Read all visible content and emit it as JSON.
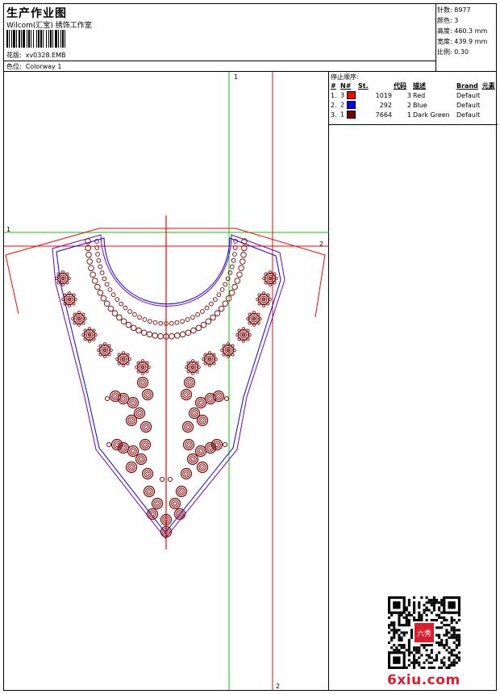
{
  "header": {
    "title": "生产作业图",
    "company": "Wilcom(汇宝) 绣饰工作室",
    "design_label": "花版:",
    "design_value": "xv0328.EMB",
    "color_label": "色位:",
    "color_value": "Colorway 1"
  },
  "specs": {
    "stitches": "针数: 8977",
    "colors": "颜色: 3",
    "height": "高度: 460.3 mm",
    "width": "宽度: 439.9 mm",
    "scale": "比例: 0.30"
  },
  "stop_sequence": {
    "caption": "停止顺序:",
    "headers": [
      "#",
      "N#",
      "St.",
      "代码",
      "描述",
      "Brand",
      "元素"
    ],
    "rows": [
      {
        "num": "1.",
        "n": "3",
        "color": "#ff0000",
        "stitches": "1019",
        "code": "3",
        "desc": "Red",
        "brand": "Default"
      },
      {
        "num": "2.",
        "n": "2",
        "color": "#0000ff",
        "stitches": "292",
        "code": "2",
        "desc": "Blue",
        "brand": "Default"
      },
      {
        "num": "3.",
        "n": "1",
        "color": "#7a0000",
        "stitches": "7664",
        "code": "1",
        "desc": "Dark Green",
        "brand": "Default"
      }
    ]
  },
  "guides": {
    "green_v_label": "1",
    "green_h_label": "1",
    "red_h_label": "2",
    "red_v_label": "2"
  },
  "watermark": {
    "text": "6xiu.com",
    "seal_text": "六秀"
  },
  "colors": {
    "embroidery": "#7a0000",
    "red_line": "#ff0000",
    "green_line": "#00cc00",
    "blue_line": "#0000ff",
    "purple_line": "#7a00b0",
    "watermark": "#d81e2f"
  }
}
